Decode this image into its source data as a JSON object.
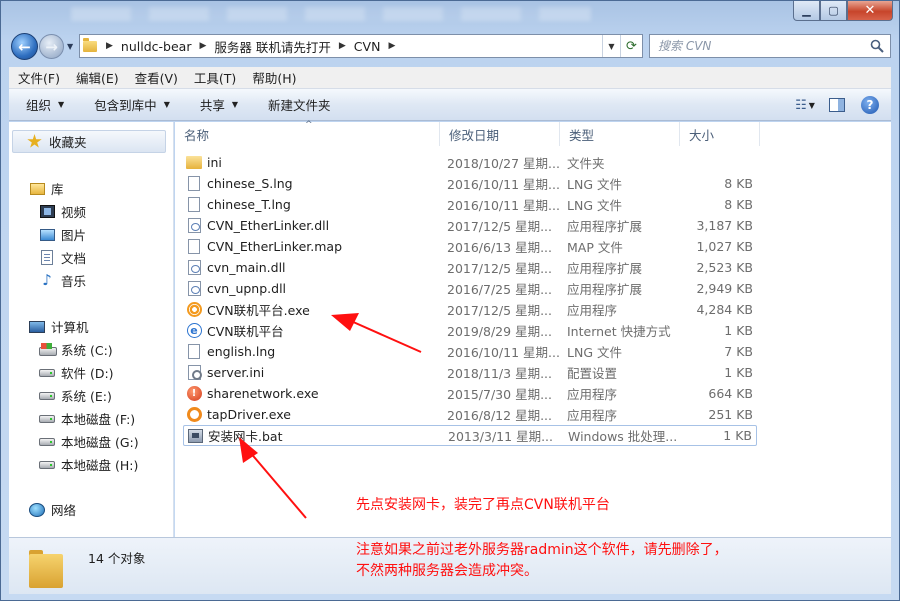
{
  "address": {
    "crumbs": [
      "nulldc-bear",
      "服务器 联机请先打开",
      "CVN"
    ]
  },
  "search": {
    "placeholder": "搜索 CVN"
  },
  "menu": [
    "文件(F)",
    "编辑(E)",
    "查看(V)",
    "工具(T)",
    "帮助(H)"
  ],
  "toolbar": {
    "organize": "组织",
    "include_library": "包含到库中",
    "share": "共享",
    "new_folder": "新建文件夹"
  },
  "nav": {
    "favorites": "收藏夹",
    "libraries": "库",
    "videos": "视频",
    "pictures": "图片",
    "documents": "文档",
    "music": "音乐",
    "computer": "计算机",
    "drives": [
      "系统 (C:)",
      "软件 (D:)",
      "系统 (E:)",
      "本地磁盘 (F:)",
      "本地磁盘 (G:)",
      "本地磁盘 (H:)"
    ],
    "network": "网络"
  },
  "columns": {
    "name": "名称",
    "date": "修改日期",
    "type": "类型",
    "size": "大小"
  },
  "files": [
    {
      "icon": "folder-icon",
      "name": "ini",
      "date": "2018/10/27 星期...",
      "type": "文件夹",
      "size": ""
    },
    {
      "icon": "file-icon",
      "name": "chinese_S.lng",
      "date": "2016/10/11 星期...",
      "type": "LNG 文件",
      "size": "8 KB"
    },
    {
      "icon": "file-icon",
      "name": "chinese_T.lng",
      "date": "2016/10/11 星期...",
      "type": "LNG 文件",
      "size": "8 KB"
    },
    {
      "icon": "dll-icon",
      "name": "CVN_EtherLinker.dll",
      "date": "2017/12/5 星期...",
      "type": "应用程序扩展",
      "size": "3,187 KB"
    },
    {
      "icon": "file-icon",
      "name": "CVN_EtherLinker.map",
      "date": "2016/6/13 星期...",
      "type": "MAP 文件",
      "size": "1,027 KB"
    },
    {
      "icon": "dll-icon",
      "name": "cvn_main.dll",
      "date": "2017/12/5 星期...",
      "type": "应用程序扩展",
      "size": "2,523 KB"
    },
    {
      "icon": "dll-icon",
      "name": "cvn_upnp.dll",
      "date": "2016/7/25 星期...",
      "type": "应用程序扩展",
      "size": "2,949 KB"
    },
    {
      "icon": "cvn-app-icon",
      "name": "CVN联机平台.exe",
      "date": "2017/12/5 星期...",
      "type": "应用程序",
      "size": "4,284 KB"
    },
    {
      "icon": "internet-shortcut-icon",
      "name": "CVN联机平台",
      "date": "2019/8/29 星期...",
      "type": "Internet 快捷方式",
      "size": "1 KB"
    },
    {
      "icon": "file-icon",
      "name": "english.lng",
      "date": "2016/10/11 星期...",
      "type": "LNG 文件",
      "size": "7 KB"
    },
    {
      "icon": "settings-file-icon",
      "name": "server.ini",
      "date": "2018/11/3 星期...",
      "type": "配置设置",
      "size": "1 KB"
    },
    {
      "icon": "sharenetwork-icon",
      "name": "sharenetwork.exe",
      "date": "2015/7/30 星期...",
      "type": "应用程序",
      "size": "664 KB"
    },
    {
      "icon": "tapdriver-icon",
      "name": "tapDriver.exe",
      "date": "2016/8/12 星期...",
      "type": "应用程序",
      "size": "251 KB"
    },
    {
      "icon": "batch-file-icon",
      "name": "安装网卡.bat",
      "date": "2013/3/11 星期...",
      "type": "Windows 批处理...",
      "size": "1 KB"
    }
  ],
  "status": {
    "count": "14 个对象"
  },
  "annotations": {
    "line1": "先点安装网卡，装完了再点CVN联机平台",
    "line2": "注意如果之前过老外服务器radmin这个软件，请先删除了，",
    "line3": "不然两种服务器会造成冲突。",
    "color": "#ff1010"
  }
}
